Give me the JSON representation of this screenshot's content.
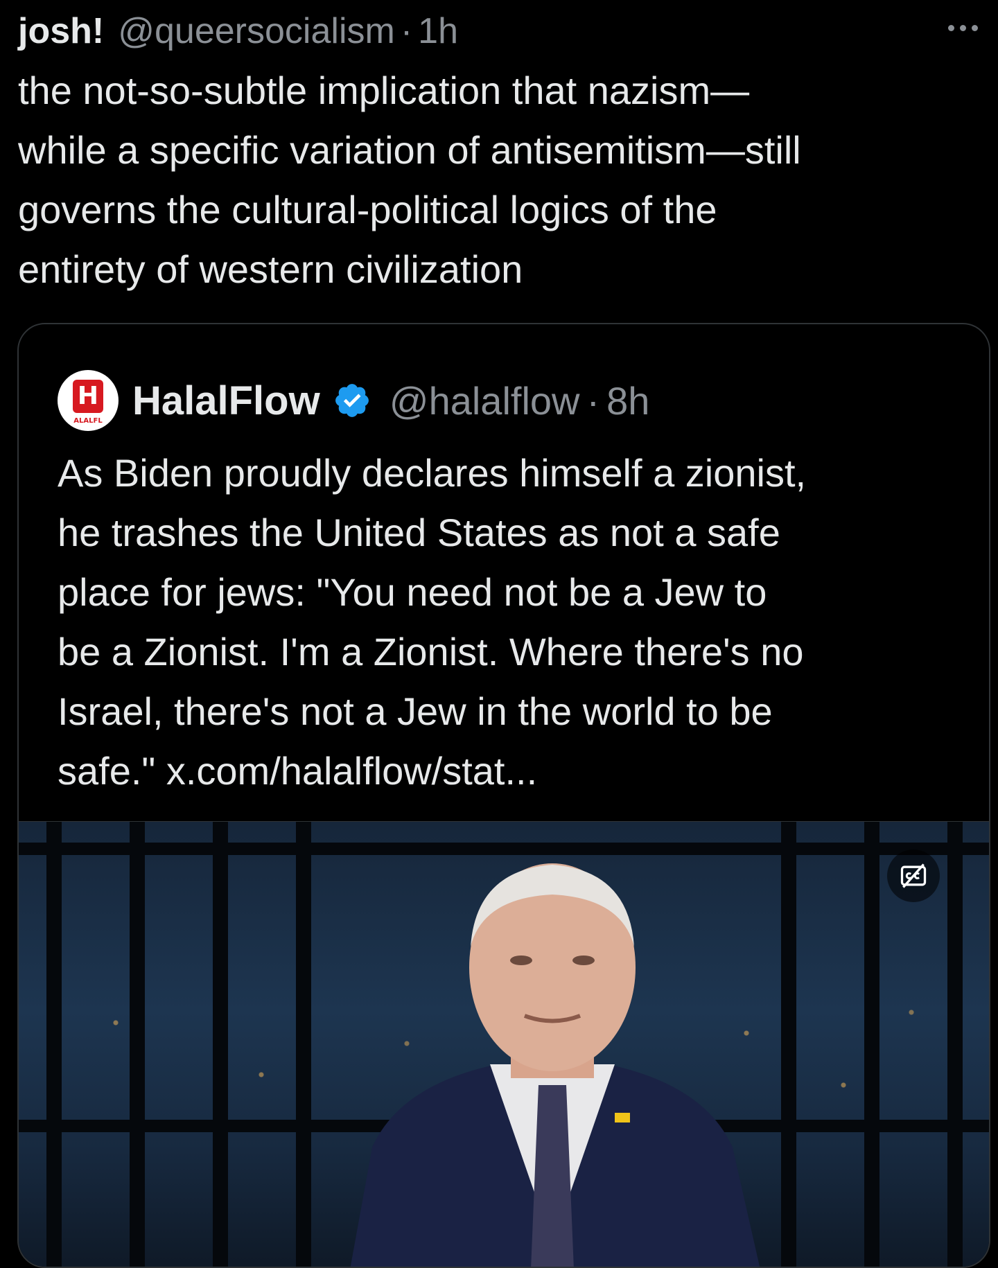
{
  "post": {
    "author_name": "josh!",
    "author_handle": "@queersocialism",
    "separator": "·",
    "time": "1h",
    "text_lines": [
      "the not-so-subtle implication that nazism—",
      "while a specific variation of antisemitism—still",
      "governs the cultural-political logics of the",
      "entirety of western civilization"
    ],
    "more_icon": "more-horizontal-icon"
  },
  "quote": {
    "author_name": "HalalFlow",
    "verified_icon": "verified-badge-icon",
    "author_handle": "@halalflow",
    "separator": "·",
    "time": "8h",
    "avatar_logo_letter": "H",
    "avatar_logo_subtext": "ALALFL",
    "text_lines": [
      "As Biden proudly declares himself a zionist,",
      "he trashes the United States as not a safe",
      "place for jews: \"You need not be a Jew to",
      "be a Zionist. I'm a Zionist. Where there's no",
      "Israel, there's not a Jew in the world to be",
      "safe.\" x.com/halalflow/stat..."
    ],
    "media": {
      "type": "video",
      "captions_icon": "closed-captions-off-icon"
    }
  },
  "colors": {
    "background": "#000000",
    "primary_text": "#e7e9ea",
    "secondary_text": "#8b9096",
    "border": "#2f3336",
    "verified_blue": "#1d9bf0",
    "logo_red": "#d71920"
  }
}
